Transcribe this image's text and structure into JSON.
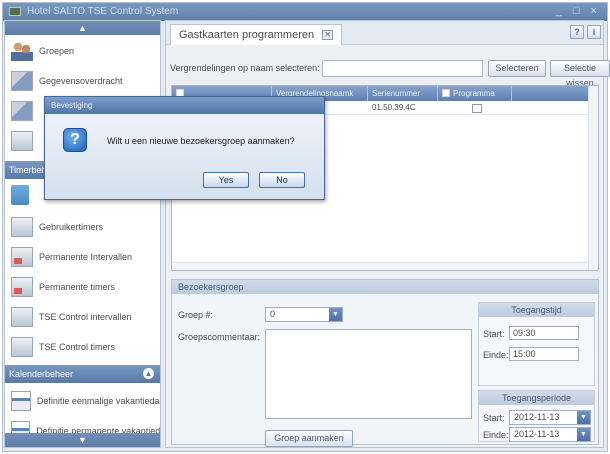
{
  "window": {
    "title": "Hotel SALTO TSE Control System",
    "controls": "_ □ ×"
  },
  "sidebar": {
    "top_items": [
      {
        "label": "Groepen",
        "icon": "people-icon"
      },
      {
        "label": "Gegevensoverdracht",
        "icon": "transfer-icon"
      }
    ],
    "timer_section": "Timerbeheer",
    "timer_items": [
      {
        "label": "Gebruikertimers",
        "icon": "timer-icon"
      },
      {
        "label": "Permanente Intervallen",
        "icon": "interval-icon"
      },
      {
        "label": "Permanente timers",
        "icon": "permanent-timer-icon"
      },
      {
        "label": "TSE Control intervallen",
        "icon": "control-interval-icon"
      },
      {
        "label": "TSE Control timers",
        "icon": "control-timer-icon"
      }
    ],
    "calendar_section": "Kalenderbeheer",
    "calendar_items": [
      {
        "label": "Definitie eenmalige vakantiedagen",
        "icon": "calendar-icon"
      },
      {
        "label": "Definitie permanente vakantiedagen",
        "icon": "calendar-icon"
      }
    ]
  },
  "main": {
    "tab_label": "Gastkaarten programmeren",
    "help_buttons": [
      "?",
      "i"
    ],
    "filter_label": "Vergrendelingen op naam selecteren:",
    "filter_value": "",
    "select_button": "Selecteren",
    "clear_button": "Selectie wissen",
    "grid": {
      "columns": [
        "",
        "Vergrendelingsnaamk",
        "Serienummer",
        "Programma"
      ],
      "rows": [
        {
          "name": "g",
          "serial": "01.50.39.4C",
          "program": false
        }
      ]
    },
    "group_box": {
      "title": "Bezoekersgroep",
      "group_label": "Groep #:",
      "group_value": "0",
      "comment_label": "Groepscommentaar:",
      "comment_value": "",
      "create_button": "Groep aanmaken",
      "access_time": {
        "title": "Toegangstijd",
        "start_label": "Start:",
        "start_value": "09:30",
        "end_label": "Einde:",
        "end_value": "15:00"
      },
      "access_period": {
        "title": "Toegangsperiode",
        "start_label": "Start:",
        "start_value": "2012-11-13",
        "end_label": "Einde:",
        "end_value": "2012-11-13"
      }
    }
  },
  "dialog": {
    "title": "Bevestiging",
    "message": "Wilt u een nieuwe bezoekersgroep aanmaken?",
    "yes_button": "Yes",
    "no_button": "No"
  }
}
